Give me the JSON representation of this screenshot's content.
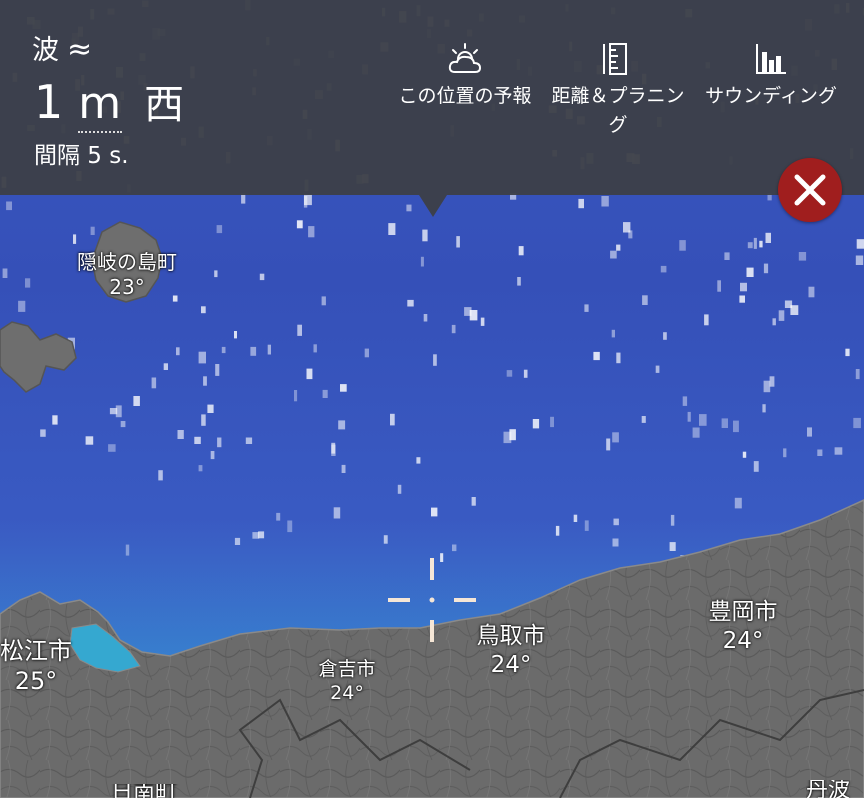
{
  "panel": {
    "layer_name": "波",
    "layer_symbol": "≈",
    "wave_height_number": "1",
    "wave_height_unit": "m",
    "wave_direction": "西",
    "interval": "間隔 5 s."
  },
  "menu": [
    {
      "label": "この位置の予報",
      "icon": "partly-cloudy-icon"
    },
    {
      "label": "距離＆プラニング",
      "icon": "ruler-icon"
    },
    {
      "label": "サウンディング",
      "icon": "bar-chart-icon"
    }
  ],
  "close_icon": "close-icon",
  "cities": [
    {
      "name": "隠岐の島町",
      "temp": "23°"
    },
    {
      "name": "松江市",
      "temp": "25°"
    },
    {
      "name": "倉吉市",
      "temp": "24°"
    },
    {
      "name": "鳥取市",
      "temp": "24°"
    },
    {
      "name": "豊岡市",
      "temp": "24°"
    },
    {
      "name": "日南町",
      "temp": ""
    },
    {
      "name": "丹波",
      "temp": ""
    }
  ],
  "colors": {
    "sea_deep": "#3347a8",
    "sea_light": "#4a68c8",
    "sea_coast": "#2aa0c8",
    "land": "#6d6d6d",
    "panel_bg": "#3c3f48",
    "close_bg": "#a01e1e"
  },
  "crosshair": "crosshair-icon"
}
